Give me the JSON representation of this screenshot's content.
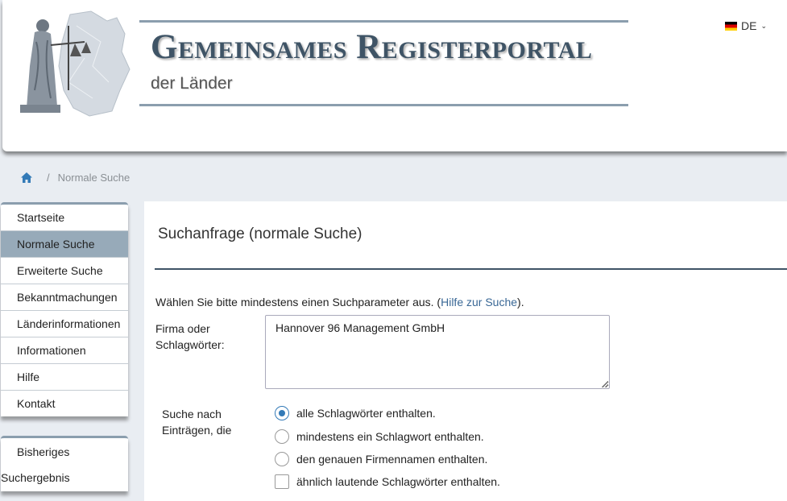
{
  "header": {
    "title": "Gemeinsames Registerportal",
    "subtitle": "der Länder",
    "language": "DE",
    "logo_icon": "justitia-germany-map-logo",
    "flag_icon": "germany-flag-icon"
  },
  "breadcrumb": {
    "home_icon": "home-icon",
    "separator": "/",
    "current": "Normale Suche"
  },
  "sidebar": {
    "items": [
      {
        "label": "Startseite",
        "active": false
      },
      {
        "label": "Normale Suche",
        "active": true
      },
      {
        "label": "Erweiterte Suche",
        "active": false
      },
      {
        "label": "Bekanntmachungen",
        "active": false
      },
      {
        "label": "Länderinformationen",
        "active": false
      },
      {
        "label": "Informationen",
        "active": false
      },
      {
        "label": "Hilfe",
        "active": false
      },
      {
        "label": "Kontakt",
        "active": false
      }
    ],
    "secondary": {
      "line1": "Bisheriges",
      "line2": "Suchergebnis"
    }
  },
  "main": {
    "title": "Suchanfrage (normale Suche)",
    "hint_prefix": "Wählen Sie bitte mindestens einen Suchparameter aus. (",
    "hint_link": "Hilfe zur Suche",
    "hint_suffix": ").",
    "firma_label": "Firma oder Schlagwörter:",
    "firma_value": "Hannover 96 Management GmbH",
    "suche_label": "Suche nach Einträgen, die",
    "options": [
      {
        "label": "alle Schlagwörter enthalten.",
        "selected": true
      },
      {
        "label": "mindestens ein Schlagwort enthalten.",
        "selected": false
      },
      {
        "label": "den genauen Firmennamen enthalten.",
        "selected": false
      }
    ],
    "similar_label": "ähnlich lautende Schlagwörter enthalten.",
    "similar_checked": false
  },
  "colors": {
    "accent": "#337ab7",
    "nav_active": "#97aab9",
    "title": "#3f5466",
    "rule": "#8b9eae"
  }
}
